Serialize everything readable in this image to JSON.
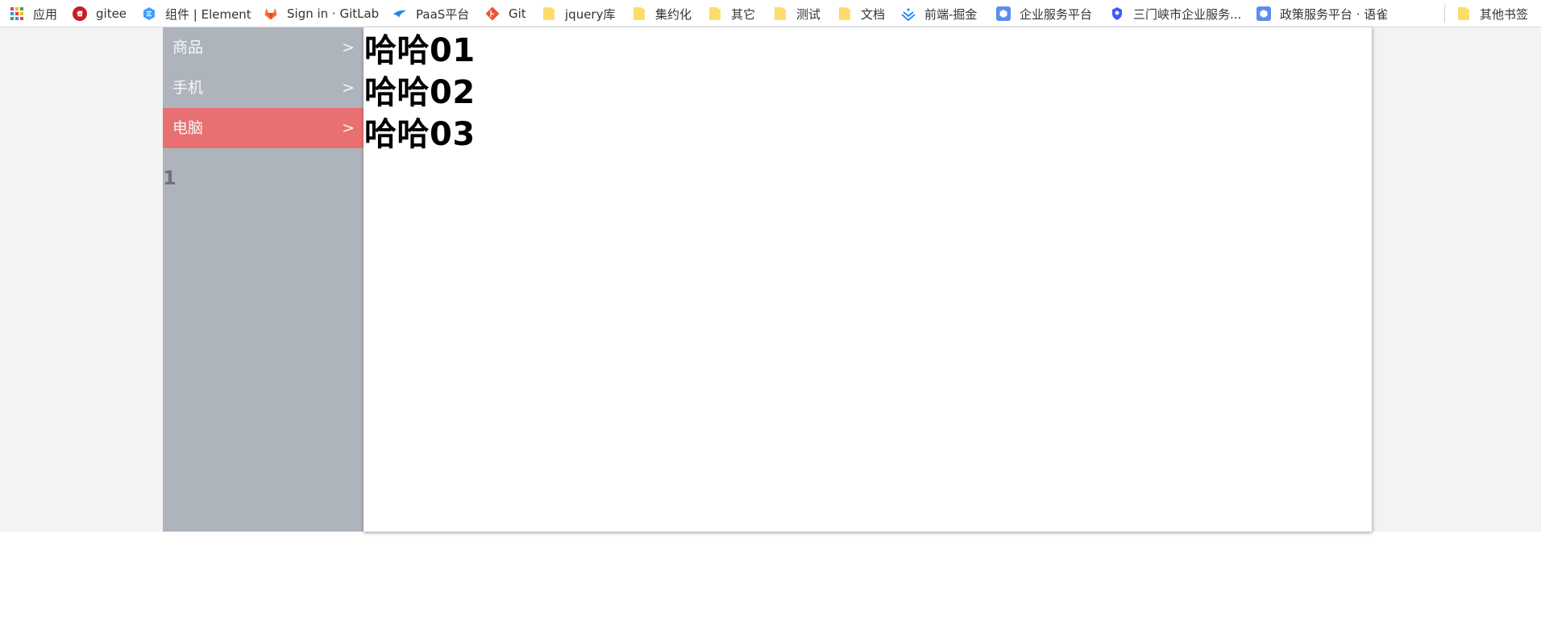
{
  "bookmarks": [
    {
      "label": "应用",
      "icon": "apps-grid-icon"
    },
    {
      "label": "gitee",
      "icon": "gitee-icon"
    },
    {
      "label": "组件 | Element",
      "icon": "element-icon"
    },
    {
      "label": "Sign in · GitLab",
      "icon": "gitlab-icon"
    },
    {
      "label": "PaaS平台",
      "icon": "paas-icon"
    },
    {
      "label": "Git",
      "icon": "git-icon"
    },
    {
      "label": "jquery库",
      "icon": "folder-icon"
    },
    {
      "label": "集约化",
      "icon": "folder-icon"
    },
    {
      "label": "其它",
      "icon": "folder-icon"
    },
    {
      "label": "测试",
      "icon": "folder-icon"
    },
    {
      "label": "文档",
      "icon": "folder-icon"
    },
    {
      "label": "前端-掘金",
      "icon": "juejin-icon"
    },
    {
      "label": "企业服务平台",
      "icon": "cube-icon"
    },
    {
      "label": "三门峡市企业服务...",
      "icon": "shield-icon"
    },
    {
      "label": "政策服务平台 · 语雀",
      "icon": "cube-icon"
    }
  ],
  "other_bookmarks": {
    "label": "其他书签",
    "icon": "folder-icon"
  },
  "sidebar": {
    "items": [
      {
        "label": "商品",
        "arrow": ">",
        "active": false
      },
      {
        "label": "手机",
        "arrow": ">",
        "active": false
      },
      {
        "label": "电脑",
        "arrow": ">",
        "active": true
      }
    ],
    "number": "1"
  },
  "content": {
    "headings": [
      "哈哈01",
      "哈哈02",
      "哈哈03"
    ]
  },
  "colors": {
    "sidebar_bg": "#aeb4bb",
    "active_item": "#e87073",
    "page_bg": "#f3f3f3"
  }
}
